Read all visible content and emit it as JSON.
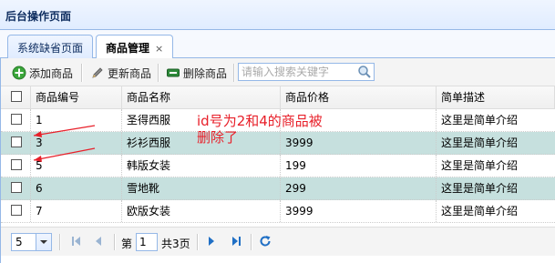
{
  "header": {
    "title": "后台操作页面"
  },
  "tabs": [
    {
      "label": "系统缺省页面",
      "active": false
    },
    {
      "label": "商品管理",
      "active": true,
      "close": "×"
    }
  ],
  "toolbar": {
    "add_label": "添加商品",
    "update_label": "更新商品",
    "delete_label": "删除商品",
    "search_placeholder": "请输入搜索关键字"
  },
  "grid": {
    "columns": [
      "商品编号",
      "商品名称",
      "商品价格",
      "简单描述"
    ],
    "rows": [
      {
        "id": "1",
        "name": "圣得西服",
        "price": "",
        "desc": "这里是简单介绍",
        "highlight": false
      },
      {
        "id": "3",
        "name": "衫衫西服",
        "price": "3999",
        "desc": "这里是简单介绍",
        "highlight": true
      },
      {
        "id": "5",
        "name": "韩版女装",
        "price": "199",
        "desc": "这里是简单介绍",
        "highlight": false
      },
      {
        "id": "6",
        "name": "雪地靴",
        "price": "299",
        "desc": "这里是简单介绍",
        "highlight": true
      },
      {
        "id": "7",
        "name": "欧版女装",
        "price": "3999",
        "desc": "这里是简单介绍",
        "highlight": false
      }
    ]
  },
  "pager": {
    "page_size": "5",
    "page_prefix": "第",
    "page_value": "1",
    "page_total": "共3页"
  },
  "annotation": {
    "line1": "id号为2和4的商品被",
    "line2": "删除了",
    "color": "#e8202a"
  }
}
